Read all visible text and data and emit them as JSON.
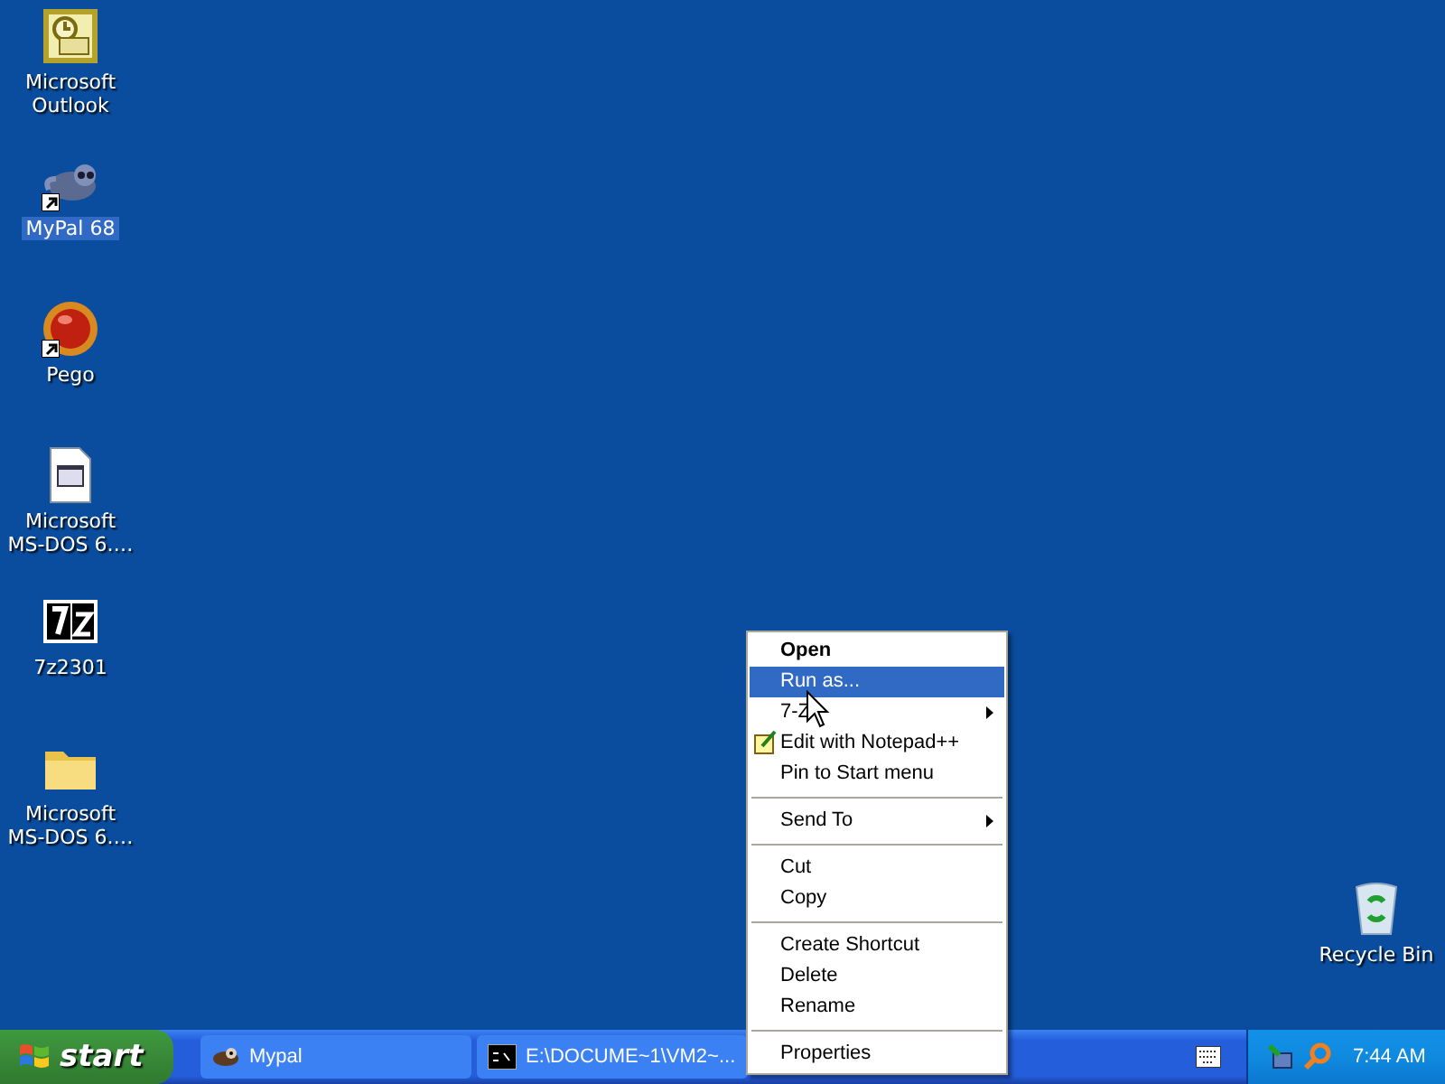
{
  "desktop_icons": [
    {
      "label": "Microsoft Outlook",
      "kind": "outlook",
      "shortcut": false,
      "selected": false
    },
    {
      "label": "MyPal 68",
      "kind": "mypal",
      "shortcut": true,
      "selected": true
    },
    {
      "label": "Pego",
      "kind": "pego",
      "shortcut": true,
      "selected": false
    },
    {
      "label": "Microsoft MS-DOS 6.…",
      "kind": "document",
      "shortcut": false,
      "selected": false
    },
    {
      "label": "7z2301",
      "kind": "sevenzip",
      "shortcut": false,
      "selected": false
    },
    {
      "label": "Microsoft MS-DOS 6.…",
      "kind": "folder",
      "shortcut": false,
      "selected": false
    }
  ],
  "recycle_bin": {
    "label": "Recycle Bin"
  },
  "context_menu": {
    "groups": [
      [
        {
          "label": "Open",
          "bold": true,
          "selected": false,
          "submenu": false,
          "icon": false
        },
        {
          "label": "Run as...",
          "bold": false,
          "selected": true,
          "submenu": false,
          "icon": false
        },
        {
          "label": "7-Z",
          "bold": false,
          "selected": false,
          "submenu": true,
          "icon": false
        },
        {
          "label": "Edit with Notepad++",
          "bold": false,
          "selected": false,
          "submenu": false,
          "icon": true
        },
        {
          "label": "Pin to Start menu",
          "bold": false,
          "selected": false,
          "submenu": false,
          "icon": false
        }
      ],
      [
        {
          "label": "Send To",
          "bold": false,
          "selected": false,
          "submenu": true,
          "icon": false
        }
      ],
      [
        {
          "label": "Cut",
          "bold": false,
          "selected": false,
          "submenu": false,
          "icon": false
        },
        {
          "label": "Copy",
          "bold": false,
          "selected": false,
          "submenu": false,
          "icon": false
        }
      ],
      [
        {
          "label": "Create Shortcut",
          "bold": false,
          "selected": false,
          "submenu": false,
          "icon": false
        },
        {
          "label": "Delete",
          "bold": false,
          "selected": false,
          "submenu": false,
          "icon": false
        },
        {
          "label": "Rename",
          "bold": false,
          "selected": false,
          "submenu": false,
          "icon": false
        }
      ],
      [
        {
          "label": "Properties",
          "bold": false,
          "selected": false,
          "submenu": false,
          "icon": false
        }
      ]
    ]
  },
  "taskbar": {
    "start_label": "start",
    "buttons": [
      {
        "label": "Mypal",
        "kind": "mypal"
      },
      {
        "label": "E:\\DOCUME~1\\VM2~...",
        "kind": "console"
      }
    ],
    "clock": "7:44 AM"
  }
}
